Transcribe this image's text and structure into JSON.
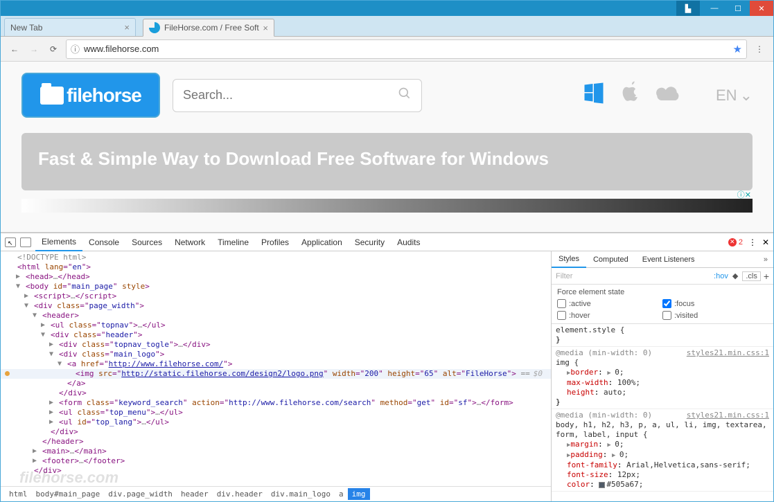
{
  "window_controls": {
    "user": "▙",
    "min": "—",
    "max": "☐",
    "close": "✕"
  },
  "tabs": [
    {
      "title": "New Tab",
      "active": false
    },
    {
      "title": "FileHorse.com / Free Soft",
      "active": true
    }
  ],
  "toolbar": {
    "url": "www.filehorse.com",
    "back_icon": "←",
    "fwd_icon": "→",
    "reload_icon": "⟳",
    "info_icon": "ⓘ",
    "star_icon": "★",
    "menu_icon": "⋮"
  },
  "page": {
    "logo_text": "filehorse",
    "search_placeholder": "Search...",
    "mag_icon": "🔍",
    "platforms": {
      "windows": "⊞",
      "apple": "",
      "cloud": "☁"
    },
    "lang": "EN",
    "lang_caret": "⌄",
    "banner": "Fast & Simple Way to Download Free Software for Windows",
    "ad_icon": "ⓘ✕"
  },
  "devtools": {
    "tabs": [
      "Elements",
      "Console",
      "Sources",
      "Network",
      "Timeline",
      "Profiles",
      "Application",
      "Security",
      "Audits"
    ],
    "active_tab": "Elements",
    "error_count": "2",
    "close_icon": "✕",
    "more_icon": "⋮",
    "dom": [
      {
        "i": 0,
        "caret": "",
        "txt": [
          [
            "gray",
            "<!DOCTYPE html>"
          ]
        ]
      },
      {
        "i": 0,
        "caret": "",
        "txt": [
          [
            "tag",
            "<html "
          ],
          [
            "attr",
            "lang"
          ],
          [
            "tag",
            "=\""
          ],
          [
            "val",
            "en"
          ],
          [
            "tag",
            "\">"
          ]
        ]
      },
      {
        "i": 1,
        "caret": "▶",
        "txt": [
          [
            "tag",
            "<head>"
          ],
          [
            "gray",
            "…"
          ],
          [
            "tag",
            "</head>"
          ]
        ]
      },
      {
        "i": 1,
        "caret": "▼",
        "txt": [
          [
            "tag",
            "<body "
          ],
          [
            "attr",
            "id"
          ],
          [
            "tag",
            "=\""
          ],
          [
            "val",
            "main_page"
          ],
          [
            "tag",
            "\" "
          ],
          [
            "attr",
            "style"
          ],
          [
            "tag",
            ">"
          ]
        ]
      },
      {
        "i": 2,
        "caret": "▶",
        "txt": [
          [
            "tag",
            "<script>"
          ],
          [
            "gray",
            "…"
          ],
          [
            "tag",
            "</script>"
          ]
        ]
      },
      {
        "i": 2,
        "caret": "▼",
        "txt": [
          [
            "tag",
            "<div "
          ],
          [
            "attr",
            "class"
          ],
          [
            "tag",
            "=\""
          ],
          [
            "val",
            "page_width"
          ],
          [
            "tag",
            "\">"
          ]
        ]
      },
      {
        "i": 3,
        "caret": "▼",
        "txt": [
          [
            "tag",
            "<header>"
          ]
        ]
      },
      {
        "i": 4,
        "caret": "▶",
        "txt": [
          [
            "tag",
            "<ul "
          ],
          [
            "attr",
            "class"
          ],
          [
            "tag",
            "=\""
          ],
          [
            "val",
            "topnav"
          ],
          [
            "tag",
            "\">"
          ],
          [
            "gray",
            "…"
          ],
          [
            "tag",
            "</ul>"
          ]
        ]
      },
      {
        "i": 4,
        "caret": "▼",
        "txt": [
          [
            "tag",
            "<div "
          ],
          [
            "attr",
            "class"
          ],
          [
            "tag",
            "=\""
          ],
          [
            "val",
            "header"
          ],
          [
            "tag",
            "\">"
          ]
        ]
      },
      {
        "i": 5,
        "caret": "▶",
        "txt": [
          [
            "tag",
            "<div "
          ],
          [
            "attr",
            "class"
          ],
          [
            "tag",
            "=\""
          ],
          [
            "val",
            "topnav_togle"
          ],
          [
            "tag",
            "\">"
          ],
          [
            "gray",
            "…"
          ],
          [
            "tag",
            "</div>"
          ]
        ]
      },
      {
        "i": 5,
        "caret": "▼",
        "txt": [
          [
            "tag",
            "<div "
          ],
          [
            "attr",
            "class"
          ],
          [
            "tag",
            "=\""
          ],
          [
            "val",
            "main_logo"
          ],
          [
            "tag",
            "\">"
          ]
        ]
      },
      {
        "i": 6,
        "caret": "▼",
        "txt": [
          [
            "tag",
            "<a "
          ],
          [
            "attr",
            "href"
          ],
          [
            "tag",
            "=\""
          ],
          [
            "link",
            "http://www.filehorse.com/"
          ],
          [
            "tag",
            "\">"
          ]
        ]
      },
      {
        "i": 7,
        "hl": true,
        "dot": true,
        "txt": [
          [
            "tag",
            "<img "
          ],
          [
            "attr",
            "src"
          ],
          [
            "tag",
            "=\""
          ],
          [
            "link",
            "http://static.filehorse.com/design2/logo.png"
          ],
          [
            "tag",
            "\" "
          ],
          [
            "attr",
            "width"
          ],
          [
            "tag",
            "=\""
          ],
          [
            "val",
            "200"
          ],
          [
            "tag",
            "\" "
          ],
          [
            "attr",
            "height"
          ],
          [
            "tag",
            "=\""
          ],
          [
            "val",
            "65"
          ],
          [
            "tag",
            "\" "
          ],
          [
            "attr",
            "alt"
          ],
          [
            "tag",
            "=\""
          ],
          [
            "val",
            "FileHorse"
          ],
          [
            "tag",
            "\">"
          ],
          [
            "gray",
            " =="
          ]
        ],
        "dim": "$0"
      },
      {
        "i": 6,
        "txt": [
          [
            "tag",
            "</a>"
          ]
        ]
      },
      {
        "i": 5,
        "txt": [
          [
            "tag",
            "</div>"
          ]
        ]
      },
      {
        "i": 5,
        "caret": "▶",
        "txt": [
          [
            "tag",
            "<form "
          ],
          [
            "attr",
            "class"
          ],
          [
            "tag",
            "=\""
          ],
          [
            "val",
            "keyword_search"
          ],
          [
            "tag",
            "\" "
          ],
          [
            "attr",
            "action"
          ],
          [
            "tag",
            "=\""
          ],
          [
            "val",
            "http://www.filehorse.com/search"
          ],
          [
            "tag",
            "\" "
          ],
          [
            "attr",
            "method"
          ],
          [
            "tag",
            "=\""
          ],
          [
            "val",
            "get"
          ],
          [
            "tag",
            "\" "
          ],
          [
            "attr",
            "id"
          ],
          [
            "tag",
            "=\""
          ],
          [
            "val",
            "sf"
          ],
          [
            "tag",
            "\">"
          ],
          [
            "gray",
            "…"
          ],
          [
            "tag",
            "</form>"
          ]
        ]
      },
      {
        "i": 5,
        "caret": "▶",
        "txt": [
          [
            "tag",
            "<ul "
          ],
          [
            "attr",
            "class"
          ],
          [
            "tag",
            "=\""
          ],
          [
            "val",
            "top_menu"
          ],
          [
            "tag",
            "\">"
          ],
          [
            "gray",
            "…"
          ],
          [
            "tag",
            "</ul>"
          ]
        ]
      },
      {
        "i": 5,
        "caret": "▶",
        "txt": [
          [
            "tag",
            "<ul "
          ],
          [
            "attr",
            "id"
          ],
          [
            "tag",
            "=\""
          ],
          [
            "val",
            "top_lang"
          ],
          [
            "tag",
            "\">"
          ],
          [
            "gray",
            "…"
          ],
          [
            "tag",
            "</ul>"
          ]
        ]
      },
      {
        "i": 4,
        "txt": [
          [
            "tag",
            "</div>"
          ]
        ]
      },
      {
        "i": 3,
        "txt": [
          [
            "tag",
            "</header>"
          ]
        ]
      },
      {
        "i": 3,
        "caret": "▶",
        "txt": [
          [
            "tag",
            "<main>"
          ],
          [
            "gray",
            "…"
          ],
          [
            "tag",
            "</main>"
          ]
        ]
      },
      {
        "i": 3,
        "caret": "▶",
        "txt": [
          [
            "tag",
            "<footer>"
          ],
          [
            "gray",
            "…"
          ],
          [
            "tag",
            "</footer>"
          ]
        ]
      },
      {
        "i": 2,
        "txt": [
          [
            "tag",
            "</div>"
          ]
        ]
      }
    ],
    "breadcrumbs": [
      "html",
      "body#main_page",
      "div.page_width",
      "header",
      "div.header",
      "div.main_logo",
      "a",
      "img"
    ],
    "breadcrumb_selected": "img",
    "styles": {
      "tabs": [
        "Styles",
        "Computed",
        "Event Listeners"
      ],
      "active": "Styles",
      "more": "»",
      "filter_placeholder": "Filter",
      "hov": ":hov",
      "cls": ".cls",
      "plus": "+",
      "force_title": "Force element state",
      "states": [
        {
          "name": ":active",
          "checked": false
        },
        {
          "name": ":hover",
          "checked": false
        },
        {
          "name": ":focus",
          "checked": true
        },
        {
          "name": ":visited",
          "checked": false
        }
      ],
      "rules": [
        {
          "sel": "element.style {",
          "src": "",
          "props": [],
          "close": "}"
        },
        {
          "media": "@media (min-width: 0)",
          "sel": "img {",
          "src": "styles21.min.css:1",
          "props": [
            {
              "n": "border",
              "v": "▶0;"
            },
            {
              "n": "max-width",
              "v": "100%;"
            },
            {
              "n": "height",
              "v": "auto;"
            }
          ],
          "close": "}"
        },
        {
          "media": "@media (min-width: 0)",
          "sel": "body, h1, h2, h3, p, a, ul, li, img, textarea, form, label, input {",
          "src": "styles21.min.css:1",
          "props": [
            {
              "n": "margin",
              "v": "▶0;"
            },
            {
              "n": "padding",
              "v": "▶0;"
            },
            {
              "n": "font-family",
              "v": "Arial,Helvetica,sans-serif;"
            },
            {
              "n": "font-size",
              "v": "12px;"
            },
            {
              "n": "color",
              "v": "#505a67;",
              "sw": "#505a67"
            }
          ],
          "close": ""
        }
      ]
    }
  },
  "watermark": "filehorse.com"
}
